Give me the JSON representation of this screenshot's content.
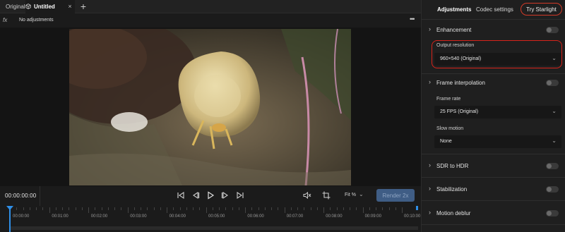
{
  "tabs": {
    "original": "Original",
    "untitled": "Untitled",
    "close": "×",
    "add": "+"
  },
  "adjustments_bar": {
    "fx": "fx",
    "label": "No adjustments",
    "more": "•••"
  },
  "controls": {
    "timecode": "00:00:00:00",
    "fit_label": "Fit %",
    "render_label": "Render 2x"
  },
  "timeline": {
    "labels": [
      "00:00:00",
      "00:01:00",
      "00:02:00",
      "00:03:00",
      "00:04:00",
      "00:05:00",
      "00:06:00",
      "00:07:00",
      "00:08:00",
      "00:09:00",
      "00:10:00"
    ]
  },
  "panel": {
    "tab_adjustments": "Adjustments",
    "tab_codec": "Codec settings",
    "try_starlight": "Try Starlight",
    "enhancement": "Enhancement",
    "output_resolution_label": "Output resolution",
    "output_resolution_value": "960×540 (Original)",
    "frame_interpolation": "Frame interpolation",
    "frame_rate_label": "Frame rate",
    "frame_rate_value": "25 FPS (Original)",
    "slow_motion_label": "Slow motion",
    "slow_motion_value": "None",
    "sdr_to_hdr": "SDR to HDR",
    "stabilization": "Stabilization",
    "motion_deblur": "Motion deblur"
  },
  "colors": {
    "accent_blue": "#2f8fe8",
    "render_button": "#3f5d85",
    "highlight_red": "#d8231a"
  }
}
